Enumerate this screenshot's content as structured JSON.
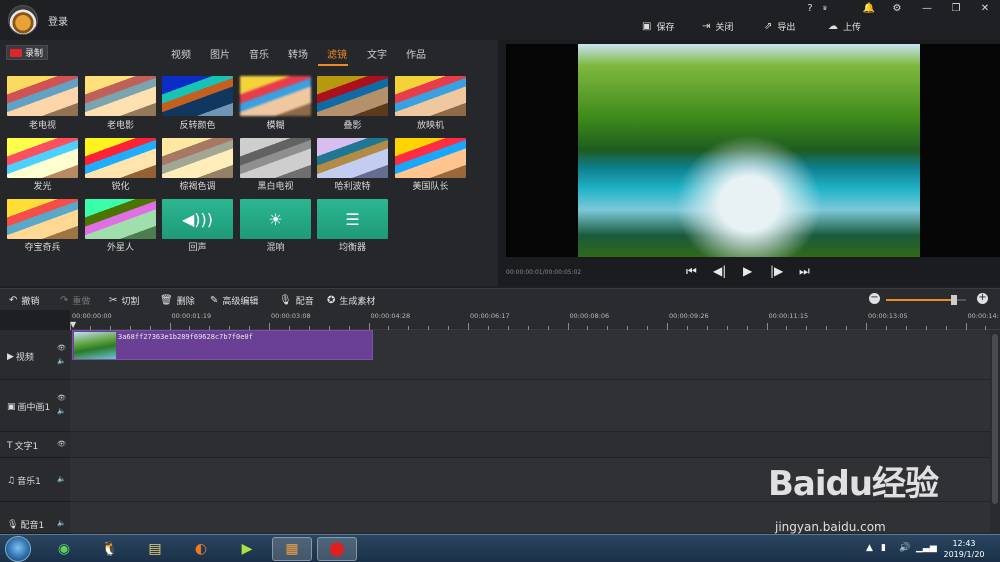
{
  "app": {
    "login_label": "登录",
    "top_icons": [
      "?",
      "VIP",
      "bell-icon",
      "gear-icon",
      "minimize-icon",
      "restore-icon",
      "close-icon"
    ],
    "top_actions": {
      "save": "保存",
      "close": "关闭",
      "export": "导出",
      "upload": "上传"
    }
  },
  "media_panel": {
    "record_label": "录制",
    "tabs": [
      {
        "label": "视频"
      },
      {
        "label": "图片"
      },
      {
        "label": "音乐"
      },
      {
        "label": "转场"
      },
      {
        "label": "滤镜",
        "active": true
      },
      {
        "label": "文字"
      },
      {
        "label": "作品"
      }
    ],
    "filters": [
      "老电视",
      "老电影",
      "反转颜色",
      "模糊",
      "叠影",
      "放映机",
      "发光",
      "锐化",
      "棕褐色调",
      "黑白电视",
      "哈利波特",
      "美国队长",
      "夺宝奇兵",
      "外星人",
      "回声",
      "混响",
      "均衡器"
    ]
  },
  "preview": {
    "timecode": "00:00:00:01/00:00:05:02"
  },
  "toolbar": {
    "undo": "撤销",
    "redo": "重做",
    "cut": "切割",
    "delete": "删除",
    "advanced_edit": "高级编辑",
    "dub": "配音",
    "generate": "生成素材",
    "zoom_level": 0.85
  },
  "timeline": {
    "ruler": [
      "00:00:00:00",
      "00:00:01:19",
      "00:00:03:08",
      "00:00:04:28",
      "00:00:06:17",
      "00:00:08:06",
      "00:00:09:26",
      "00:00:11:15",
      "00:00:13:05",
      "00:00:14:"
    ],
    "tracks": [
      {
        "name": "视频"
      },
      {
        "name": "画中画1"
      },
      {
        "name": "文字1"
      },
      {
        "name": "音乐1"
      },
      {
        "name": "配音1"
      }
    ],
    "clip_id": "3a68ff27363e1b289f69628c7b7f0e0f"
  },
  "taskbar": {
    "time": "12:43",
    "date": "2019/1/20"
  },
  "watermark": {
    "logo": "Baidu经验",
    "url": "jingyan.baidu.com"
  }
}
